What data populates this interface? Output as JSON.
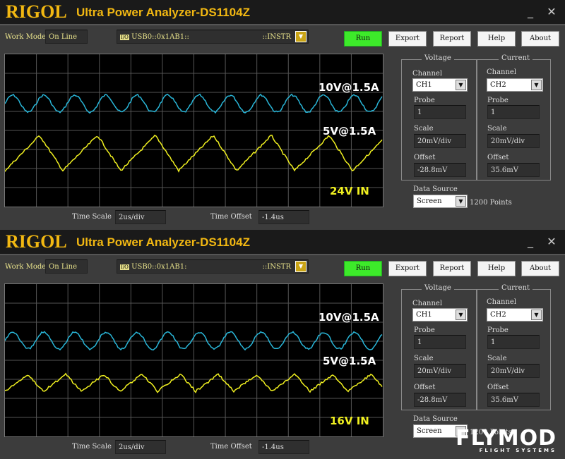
{
  "app": {
    "logo": "RIGOL",
    "title": "Ultra Power Analyzer-DS1104Z",
    "minimize": "_",
    "close": "✕"
  },
  "colors": {
    "ch1": "#29b6d8",
    "ch2": "#f0f020",
    "accent": "#f2b812",
    "run": "#3dea2a"
  },
  "panels": [
    {
      "work_mode_label": "Work Mode",
      "work_mode": "On Line",
      "io": "I/O",
      "resource": "USB0::0x1AB1::",
      "resource_suffix": "::INSTR",
      "buttons": {
        "run": "Run",
        "export": "Export",
        "report": "Report",
        "help": "Help",
        "about": "About"
      },
      "trace_labels": {
        "ch1": "10V@1.5A",
        "ch2": "5V@1.5A",
        "input": "24V IN"
      },
      "voltage": {
        "title": "Voltage",
        "channel_label": "Channel",
        "channel": "CH1",
        "probe_label": "Probe",
        "probe": "1",
        "scale_label": "Scale",
        "scale": "20mV/div",
        "offset_label": "Offset",
        "offset": "-28.8mV"
      },
      "current": {
        "title": "Current",
        "channel_label": "Channel",
        "channel": "CH2",
        "probe_label": "Probe",
        "probe": "1",
        "scale_label": "Scale",
        "scale": "20mV/div",
        "offset_label": "Offset",
        "offset": "35.6mV"
      },
      "data_source_label": "Data Source",
      "data_source": "Screen",
      "points": "1200 Points",
      "time_scale_label": "Time Scale",
      "time_scale": "2us/div",
      "time_offset_label": "Time Offset",
      "time_offset": "-1.4us"
    },
    {
      "work_mode_label": "Work Mode",
      "work_mode": "On Line",
      "io": "I/O",
      "resource": "USB0::0x1AB1:",
      "resource_suffix": "::INSTR",
      "buttons": {
        "run": "Run",
        "export": "Export",
        "report": "Report",
        "help": "Help",
        "about": "About"
      },
      "trace_labels": {
        "ch1": "10V@1.5A",
        "ch2": "5V@1.5A",
        "input": "16V IN"
      },
      "voltage": {
        "title": "Voltage",
        "channel_label": "Channel",
        "channel": "CH1",
        "probe_label": "Probe",
        "probe": "1",
        "scale_label": "Scale",
        "scale": "20mV/div",
        "offset_label": "Offset",
        "offset": "-28.8mV"
      },
      "current": {
        "title": "Current",
        "channel_label": "Channel",
        "channel": "CH2",
        "probe_label": "Probe",
        "probe": "1",
        "scale_label": "Scale",
        "scale": "20mV/div",
        "offset_label": "Offset",
        "offset": "35.6mV"
      },
      "data_source_label": "Data Source",
      "data_source": "Screen",
      "points": "1200 Points",
      "time_scale_label": "Time Scale",
      "time_scale": "2us/div",
      "time_offset_label": "Time Offset",
      "time_offset": "-1.4us"
    }
  ],
  "watermark_logo": {
    "text": "FLYMOD",
    "sub": "FLIGHT SYSTEMS"
  }
}
